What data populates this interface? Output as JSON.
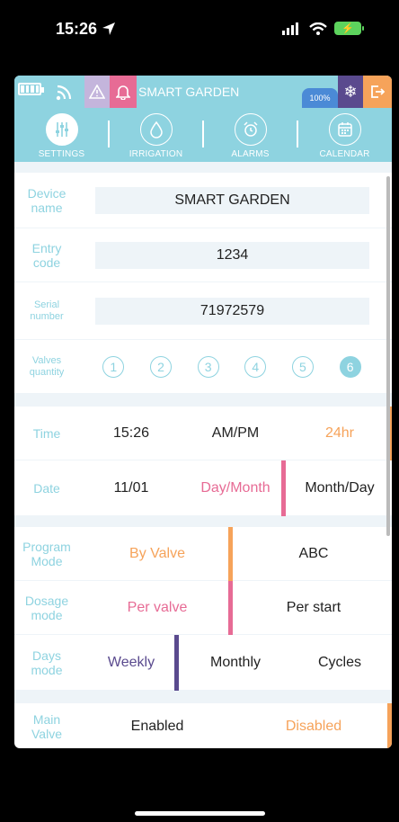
{
  "status_bar": {
    "time": "15:26"
  },
  "topbar": {
    "title": "SMART GARDEN",
    "battery_pct": "100%"
  },
  "tabs": [
    {
      "label": "SETTINGS",
      "icon": "sliders-icon",
      "active": true
    },
    {
      "label": "IRRIGATION",
      "icon": "water-drop-icon",
      "active": false
    },
    {
      "label": "ALARMS",
      "icon": "alarm-clock-icon",
      "active": false
    },
    {
      "label": "CALENDAR",
      "icon": "calendar-icon",
      "active": false
    }
  ],
  "device": {
    "name_label": "Device name",
    "name_value": "SMART GARDEN",
    "code_label": "Entry code",
    "code_value": "1234",
    "serial_label": "Serial number",
    "serial_value": "71972579",
    "valves_label": "Valves quantity",
    "valves": [
      "1",
      "2",
      "3",
      "4",
      "5",
      "6"
    ],
    "valves_selected": "6"
  },
  "time_row": {
    "label": "Time",
    "value": "15:26",
    "opt1": "AM/PM",
    "opt2": "24hr"
  },
  "date_row": {
    "label": "Date",
    "value": "11/01",
    "opt1": "Day/Month",
    "opt2": "Month/Day"
  },
  "program_row": {
    "label": "Program Mode",
    "opt1": "By Valve",
    "opt2": "ABC"
  },
  "dosage_row": {
    "label": "Dosage mode",
    "opt1": "Per valve",
    "opt2": "Per start"
  },
  "days_row": {
    "label": "Days mode",
    "opt1": "Weekly",
    "opt2": "Monthly",
    "opt3": "Cycles"
  },
  "valve_row": {
    "label": "Main Valve",
    "opt1": "Enabled",
    "opt2": "Disabled"
  },
  "colors": {
    "accent": "#8ed3e0",
    "orange": "#f6a35a",
    "pink": "#e76b95",
    "purple": "#5a4a8e",
    "divider": "#eef4f8"
  }
}
